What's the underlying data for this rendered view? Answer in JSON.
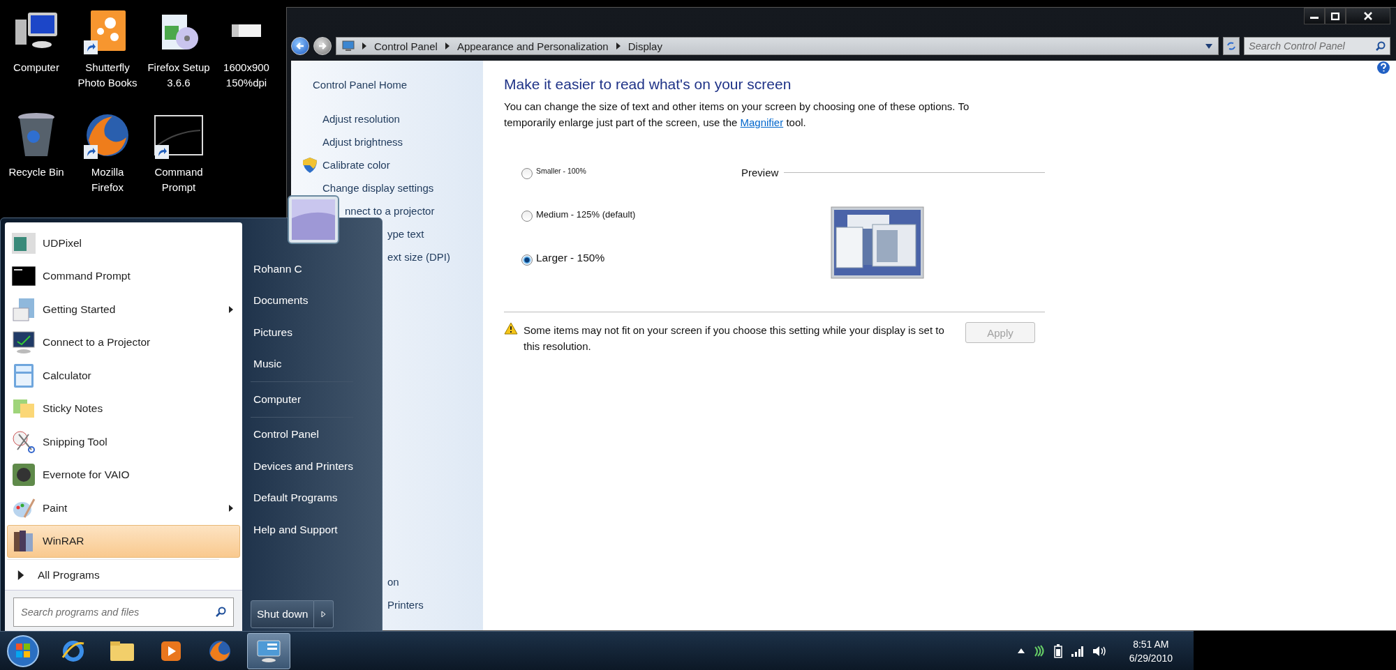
{
  "desktop_icons": [
    {
      "label": "Computer",
      "shortcut": false
    },
    {
      "label": "Shutterfly Photo Books",
      "shortcut": true
    },
    {
      "label": "Firefox Setup 3.6.6",
      "shortcut": false
    },
    {
      "label": "1600x900 150%dpi",
      "shortcut": false
    },
    {
      "label": "Recycle Bin",
      "shortcut": false
    },
    {
      "label": "Mozilla Firefox",
      "shortcut": true
    },
    {
      "label": "Command Prompt",
      "shortcut": true
    }
  ],
  "window": {
    "address": {
      "crumbs": [
        "Control Panel",
        "Appearance and Personalization",
        "Display"
      ],
      "search_placeholder": "Search Control Panel"
    },
    "sidebar": {
      "home": "Control Panel Home",
      "items": [
        {
          "label": "Adjust resolution",
          "kind": "link",
          "shield": false
        },
        {
          "label": "Adjust brightness",
          "kind": "link",
          "shield": false
        },
        {
          "label": "Calibrate color",
          "kind": "link",
          "shield": true
        },
        {
          "label": "Change display settings",
          "kind": "link",
          "shield": false
        },
        {
          "label": "nnect to a projector",
          "kind": "under_tile",
          "shield": false
        },
        {
          "label": "ype text",
          "kind": "under_menu",
          "shield": false
        },
        {
          "label": "ext size (DPI)",
          "kind": "under_menu",
          "shield": false
        }
      ],
      "see_also": [
        {
          "label": "on"
        },
        {
          "label": "Printers"
        }
      ]
    },
    "main": {
      "title": "Make it easier to read what's on your screen",
      "intro_before": "You can change the size of text and other items on your screen by choosing one of these options. To temporarily enlarge just part of the screen, use the",
      "intro_link": "Magnifier",
      "intro_after": "tool.",
      "options": [
        {
          "label": "Smaller - 100%",
          "kind": "small",
          "selected": false
        },
        {
          "label": "Medium - 125% (default)",
          "kind": "medium",
          "selected": false
        },
        {
          "label": "Larger - 150%",
          "kind": "large",
          "selected": true
        }
      ],
      "preview_label": "Preview",
      "warning": "Some items may not fit on your screen if you choose this setting while your display is set to this resolution.",
      "apply": {
        "label": "Apply",
        "disabled": true
      }
    }
  },
  "start_menu": {
    "programs": [
      {
        "label": "UDPixel",
        "submenu": false,
        "selected": false
      },
      {
        "label": "Command Prompt",
        "submenu": false,
        "selected": false
      },
      {
        "label": "Getting Started",
        "submenu": true,
        "selected": false
      },
      {
        "label": "Connect to a Projector",
        "submenu": false,
        "selected": false
      },
      {
        "label": "Calculator",
        "submenu": false,
        "selected": false
      },
      {
        "label": "Sticky Notes",
        "submenu": false,
        "selected": false
      },
      {
        "label": "Snipping Tool",
        "submenu": false,
        "selected": false
      },
      {
        "label": "Evernote for VAIO",
        "submenu": false,
        "selected": false
      },
      {
        "label": "Paint",
        "submenu": true,
        "selected": false
      },
      {
        "label": "WinRAR",
        "submenu": false,
        "selected": true
      }
    ],
    "all_programs": "All Programs",
    "search_placeholder": "Search programs and files",
    "place_groups": [
      {
        "items": [
          "Rohann C",
          "Documents",
          "Pictures",
          "Music"
        ]
      },
      {
        "items": [
          "Computer"
        ]
      },
      {
        "items": [
          "Control Panel",
          "Devices and Printers",
          "Default Programs",
          "Help and Support"
        ]
      }
    ],
    "shutdown": "Shut down"
  },
  "taskbar": {
    "apps": [
      {
        "selected": false
      },
      {
        "selected": false
      },
      {
        "selected": false
      },
      {
        "selected": false
      },
      {
        "selected": true
      }
    ],
    "time": "8:51 AM",
    "date": "6/29/2010"
  }
}
